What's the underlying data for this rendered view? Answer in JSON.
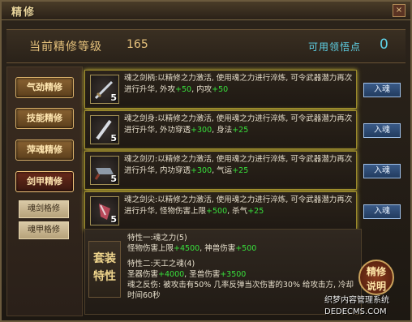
{
  "window": {
    "title": "精修",
    "close_label": "×"
  },
  "level": {
    "label": "当前精修等级",
    "value": "165"
  },
  "points": {
    "label": "可用领悟点",
    "value": "0"
  },
  "nav": [
    {
      "label": "气劲精修"
    },
    {
      "label": "技能精修"
    },
    {
      "label": "萍魂精修"
    },
    {
      "label": "剑甲精修"
    }
  ],
  "subnav": [
    {
      "label": "魂剑格修"
    },
    {
      "label": "魂甲格修"
    }
  ],
  "rows": [
    {
      "level": "5",
      "text": "魂之剑柄:以精修之力激活, 使用魂之力进行淬炼, 可令武器潜力再次进行升华, 外攻",
      "bonus1": "+50",
      "mid": ", 内攻",
      "bonus2": "+50",
      "button": "入魂"
    },
    {
      "level": "5",
      "text": "魂之剑身:以精修之力激活, 使用魂之力进行淬炼, 可令武器潜力再次进行升华, 外功穿透",
      "bonus1": "+300",
      "mid": ", 身法",
      "bonus2": "+25",
      "button": "入魂"
    },
    {
      "level": "5",
      "text": "魂之剑刃:以精修之力激活, 使用魂之力进行淬炼, 可令武器潜力再次进行升华, 内功穿透",
      "bonus1": "+300",
      "mid": ", 气运",
      "bonus2": "+25",
      "button": "入魂"
    },
    {
      "level": "5",
      "text": "魂之剑尖:以精修之力激活, 使用魂之力进行淬炼, 可令武器潜力再次进行升华, 怪物伤害上限",
      "bonus1": "+500",
      "mid": ", 杀气",
      "bonus2": "+25",
      "button": "入魂"
    }
  ],
  "set": {
    "label_line1": "套装",
    "label_line2": "特性",
    "trait1_title": "特性一:魂之力(5)",
    "trait1_l1a": "怪物伤害上限",
    "trait1_l1b": "+4500",
    "trait1_l1c": ", 神兽伤害",
    "trait1_l1d": "+500",
    "trait2_title": "特性二:天工之魂(4)",
    "trait2_l1a": "圣器伤害",
    "trait2_l1b": "+4000",
    "trait2_l1c": ", 圣兽伤害",
    "trait2_l1d": "+3500",
    "trait2_l2": "魂之反伤: 被攻击有50% 几率反弹当次伤害的30% 给攻击方, 冷却时间60秒"
  },
  "help": {
    "line1": "精修",
    "line2": "说明"
  },
  "watermark": {
    "line1": "织梦内容管理系统",
    "line2": "DEDECMS.COM"
  }
}
